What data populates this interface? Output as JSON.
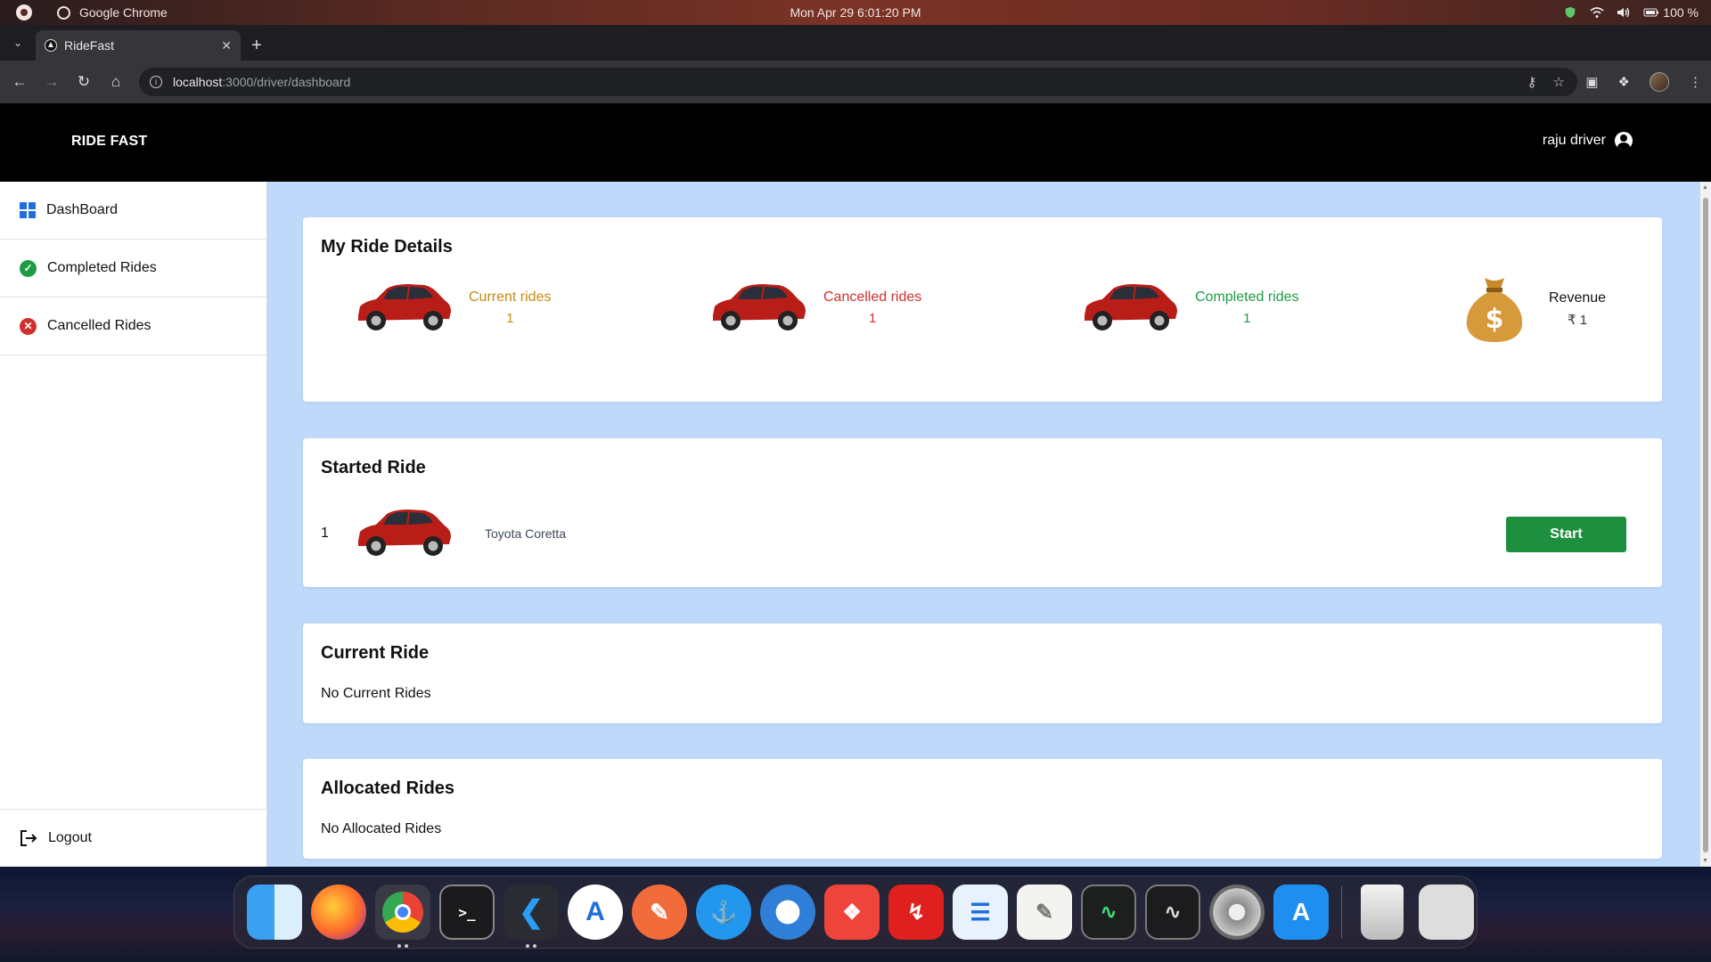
{
  "os": {
    "app_name": "Google Chrome",
    "datetime": "Mon Apr 29   6:01:20 PM",
    "battery": "100 %"
  },
  "browser": {
    "tab_title": "RideFast",
    "url_host": "localhost",
    "url_path": ":3000/driver/dashboard"
  },
  "app": {
    "brand": "RIDE FAST",
    "user_name": "raju driver",
    "sidebar": {
      "items": [
        {
          "label": "DashBoard"
        },
        {
          "label": "Completed Rides"
        },
        {
          "label": "Cancelled Rides"
        }
      ],
      "logout": "Logout"
    },
    "ride_details": {
      "title": "My Ride Details",
      "stats": [
        {
          "label": "Current rides",
          "value": "1",
          "color": "#c98a14"
        },
        {
          "label": "Cancelled rides",
          "value": "1",
          "color": "#d32f2f"
        },
        {
          "label": "Completed rides",
          "value": "1",
          "color": "#1e9b45"
        },
        {
          "label": "Revenue",
          "value": "₹ 1",
          "color": "#111111"
        }
      ]
    },
    "started_ride": {
      "title": "Started Ride",
      "rows": [
        {
          "number": "1",
          "model": "Toyota Coretta",
          "action": "Start"
        }
      ]
    },
    "current_ride": {
      "title": "Current Ride",
      "empty": "No Current Rides"
    },
    "allocated_rides": {
      "title": "Allocated Rides",
      "empty": "No Allocated Rides"
    }
  },
  "dock": {
    "apps": [
      "finder-icon",
      "firefox-icon",
      "chrome-icon",
      "terminal-icon",
      "vscode-icon",
      "app-store-icon",
      "postman-icon",
      "docker-icon",
      "thunderbird-icon",
      "anydesk-icon",
      "pdf-reader-icon",
      "text-editor-icon",
      "notes-icon",
      "activity-monitor-icon",
      "system-monitor-icon",
      "settings-icon",
      "software-updater-icon",
      "trash-icon",
      "launchpad-icon"
    ]
  }
}
